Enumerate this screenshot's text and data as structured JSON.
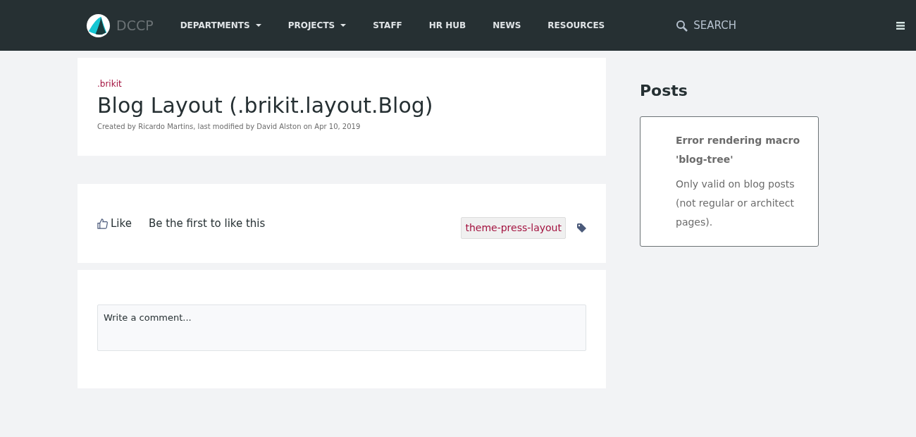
{
  "navbar": {
    "brand": "DCCP",
    "items": [
      {
        "label": "DEPARTMENTS",
        "dropdown": true
      },
      {
        "label": "PROJECTS",
        "dropdown": true
      },
      {
        "label": "STAFF",
        "dropdown": false
      },
      {
        "label": "HR HUB",
        "dropdown": false
      },
      {
        "label": "NEWS",
        "dropdown": false
      },
      {
        "label": "RESOURCES",
        "dropdown": false
      }
    ],
    "search": "SEARCH"
  },
  "page": {
    "space": ".brikit",
    "title": "Blog Layout (.brikit.layout.Blog)",
    "byline": "Created by Ricardo Martins, last modified by David Alston on Apr 10, 2019"
  },
  "likes": {
    "like": "Like",
    "summary": "Be the first to like this",
    "labels": [
      "theme-press-layout"
    ]
  },
  "comment": {
    "placeholder": "Write a comment..."
  },
  "sidebar": {
    "title": "Posts",
    "error_title": "Error rendering macro 'blog-tree'",
    "error_text": "Only valid on blog posts (not regular or architect pages)."
  }
}
